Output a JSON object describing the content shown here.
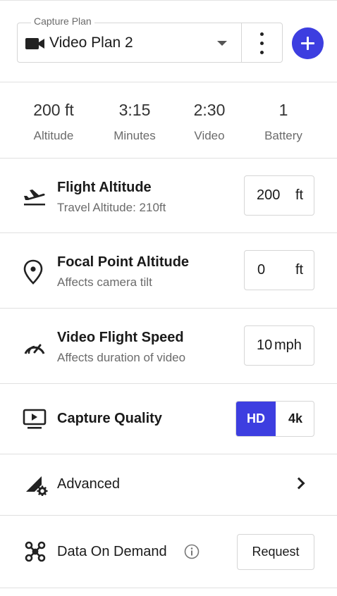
{
  "header": {
    "plan_legend": "Capture Plan",
    "plan_value": "Video Plan 2",
    "icons": {
      "camera": "video-camera-icon",
      "caret": "caret-down-icon",
      "more": "more-vertical-icon",
      "add": "plus-icon"
    }
  },
  "stats": [
    {
      "value": "200 ft",
      "label": "Altitude"
    },
    {
      "value": "3:15",
      "label": "Minutes"
    },
    {
      "value": "2:30",
      "label": "Video"
    },
    {
      "value": "1",
      "label": "Battery"
    }
  ],
  "flight_altitude": {
    "title": "Flight Altitude",
    "subtitle": "Travel Altitude: 210ft",
    "value": "200",
    "unit": "ft",
    "icon": "takeoff-icon"
  },
  "focal_point": {
    "title": "Focal Point Altitude",
    "subtitle": "Affects camera tilt",
    "value": "0",
    "unit": "ft",
    "icon": "location-pin-icon"
  },
  "flight_speed": {
    "title": "Video Flight Speed",
    "subtitle": "Affects duration of video",
    "value": "10",
    "unit": "mph",
    "icon": "speedometer-icon"
  },
  "capture_quality": {
    "title": "Capture Quality",
    "options": [
      "HD",
      "4k"
    ],
    "selected": "HD",
    "icon": "monitor-play-icon"
  },
  "advanced": {
    "title": "Advanced",
    "icon": "signal-gear-icon"
  },
  "data_on_demand": {
    "title": "Data On Demand",
    "button": "Request",
    "icon": "drone-icon"
  },
  "colors": {
    "accent": "#3d3ee0",
    "text": "#1a1a1a",
    "muted": "#6b6b6b",
    "border": "#d6d6d6"
  }
}
